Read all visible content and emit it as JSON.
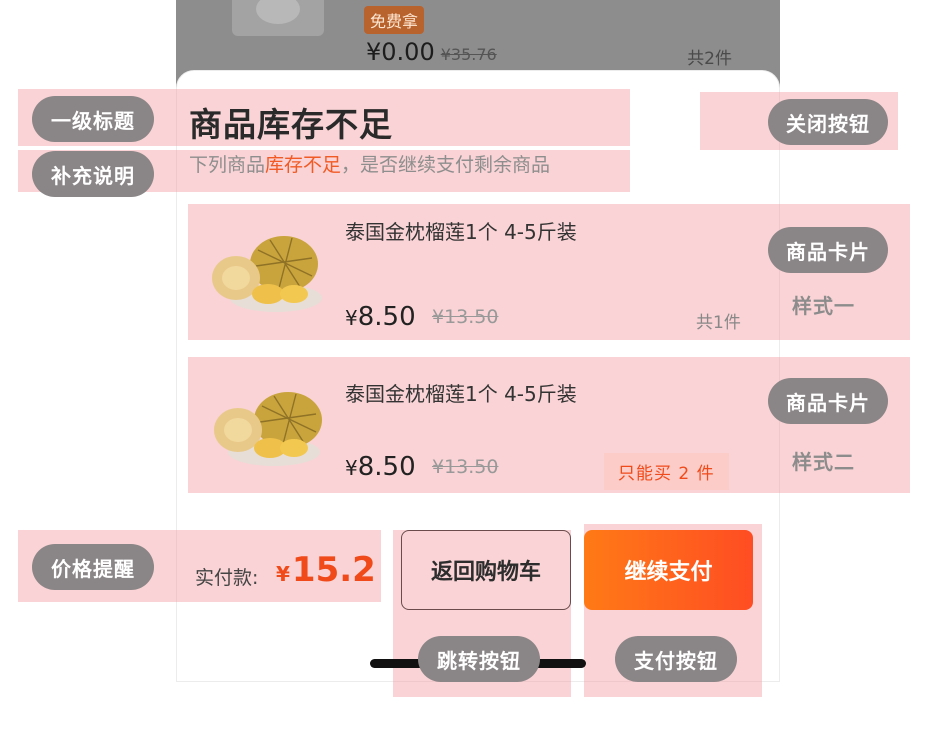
{
  "background": {
    "badge": "免费拿",
    "price": "¥0.00",
    "orig_price": "¥35.76",
    "count": "共2件"
  },
  "sheet": {
    "title": "商品库存不足",
    "subtitle_prefix": "下列商品",
    "subtitle_warn": "库存不足",
    "subtitle_suffix": "，是否继续支付剩余商品",
    "products": [
      {
        "name": "泰国金枕榴莲1个 4-5斤装",
        "currency": "¥",
        "price": "8.50",
        "orig_price": "¥13.50",
        "count": "共1件"
      },
      {
        "name": "泰国金枕榴莲1个 4-5斤装",
        "currency": "¥",
        "price": "8.50",
        "orig_price": "¥13.50",
        "limit": "只能买 2 件"
      }
    ],
    "footer": {
      "pay_label": "实付款:",
      "currency": "¥",
      "amount": "15.2",
      "back_button": "返回购物车",
      "pay_button": "继续支付"
    }
  },
  "annotations": {
    "title_tag": "一级标题",
    "subtitle_tag": "补充说明",
    "close_tag": "关闭按钮",
    "card_tag_1": "商品卡片",
    "card_style_1": "样式一",
    "card_tag_2": "商品卡片",
    "card_style_2": "样式二",
    "price_tag": "价格提醒",
    "jump_tag": "跳转按钮",
    "pay_tag": "支付按钮"
  },
  "colors": {
    "accent": "#f15a24",
    "pay_gradient_start": "#ff7a16",
    "pay_gradient_end": "#ff4d23",
    "annotation_highlight": "#f0969b",
    "annotation_pill": "#8a8586"
  },
  "icons": [
    "durian-product-image"
  ]
}
